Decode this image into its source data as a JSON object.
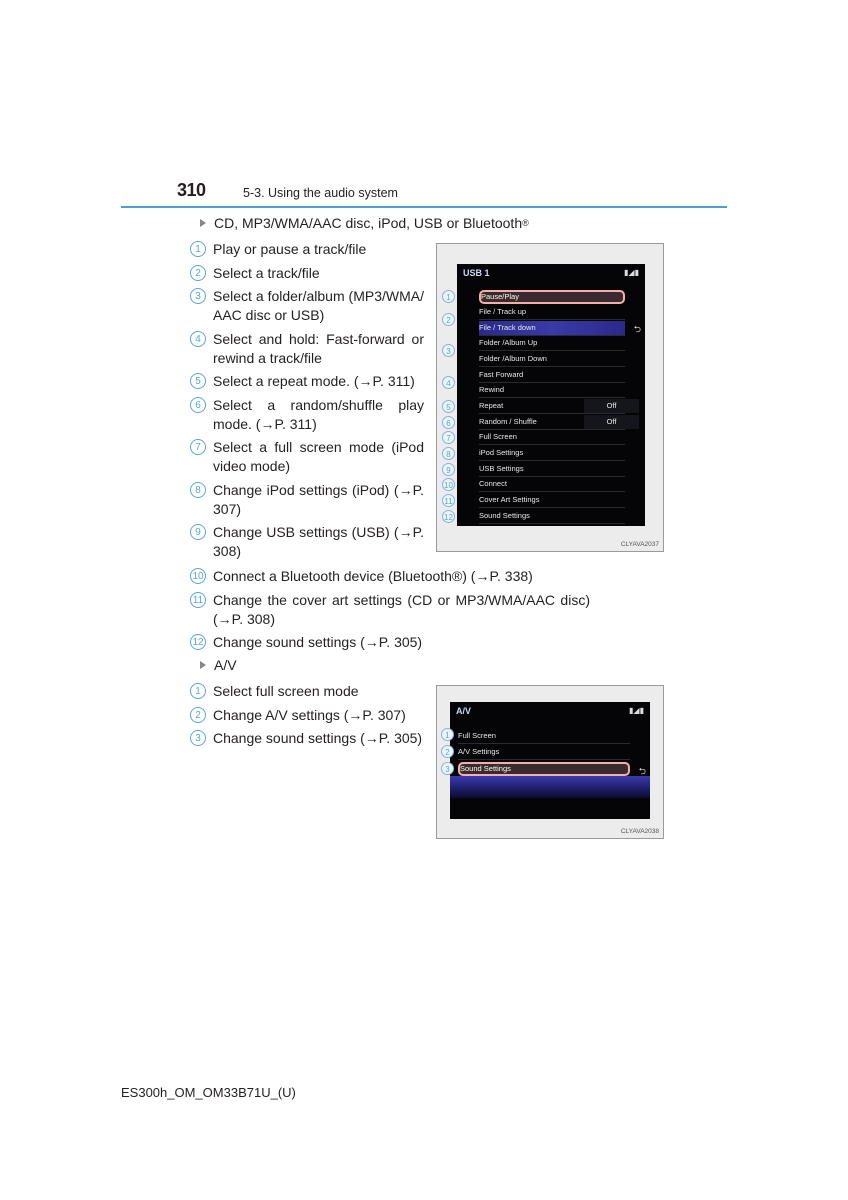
{
  "header": {
    "page_number": "310",
    "section": "5-3. Using the audio system",
    "accent": "#4a9fd6"
  },
  "section1": {
    "heading": "CD, MP3/WMA/AAC disc, iPod, USB or Bluetooth",
    "heading_sup": "®",
    "items": [
      {
        "n": "1",
        "text": "Play or pause a track/file"
      },
      {
        "n": "2",
        "text": "Select a track/file"
      },
      {
        "n": "3",
        "text": "Select a folder/album (MP3/WMA/ AAC disc or USB)"
      },
      {
        "n": "4",
        "text": "Select and hold: Fast-forward or rewind a track/file"
      },
      {
        "n": "5",
        "text": "Select a repeat mode. (→P. 311)"
      },
      {
        "n": "6",
        "text": "Select a random/shuffle play mode. (→P. 311)"
      },
      {
        "n": "7",
        "text": "Select a full screen mode (iPod video mode)"
      },
      {
        "n": "8",
        "text": "Change iPod settings (iPod) (→P. 307)"
      },
      {
        "n": "9",
        "text": "Change USB settings (USB) (→P. 308)"
      },
      {
        "n": "10",
        "text": "Connect a Bluetooth device (Bluetooth®) (→P. 338)"
      },
      {
        "n": "11",
        "text": "Change the cover art settings (CD or MP3/WMA/AAC disc) (→P. 308)"
      },
      {
        "n": "12",
        "text": "Change sound settings (→P. 305)"
      }
    ],
    "figure": {
      "title": "USB 1",
      "status": "▮◢▮",
      "code": "CLYAVA2037",
      "back": "⮌",
      "rows": [
        "Pause/Play",
        "File / Track up",
        "File / Track down",
        "Folder /Album Up",
        "Folder /Album Down",
        "Fast Forward",
        "Rewind",
        "Repeat",
        "Random / Shuffle",
        "Full Screen",
        "iPod Settings",
        "USB Settings",
        "Connect",
        "Cover Art Settings",
        "Sound Settings"
      ],
      "repeat_value": "Off",
      "shuffle_value": "Off",
      "labels": [
        "1",
        "2",
        "3",
        "4",
        "5",
        "6",
        "7",
        "8",
        "9",
        "10",
        "11",
        "12"
      ]
    }
  },
  "section2": {
    "heading": "A/V",
    "items": [
      {
        "n": "1",
        "text": "Select full screen mode"
      },
      {
        "n": "2",
        "text": "Change A/V settings (→P. 307)"
      },
      {
        "n": "3",
        "text": "Change sound settings (→P. 305)"
      }
    ],
    "figure": {
      "title": "A/V",
      "status": "▮◢▮",
      "code": "CLYAVA2038",
      "back": "⮌",
      "rows": [
        "Full Screen",
        "A/V Settings",
        "Sound Settings"
      ],
      "labels": [
        "1",
        "2",
        "3"
      ]
    }
  },
  "footer": "ES300h_OM_OM33B71U_(U)"
}
